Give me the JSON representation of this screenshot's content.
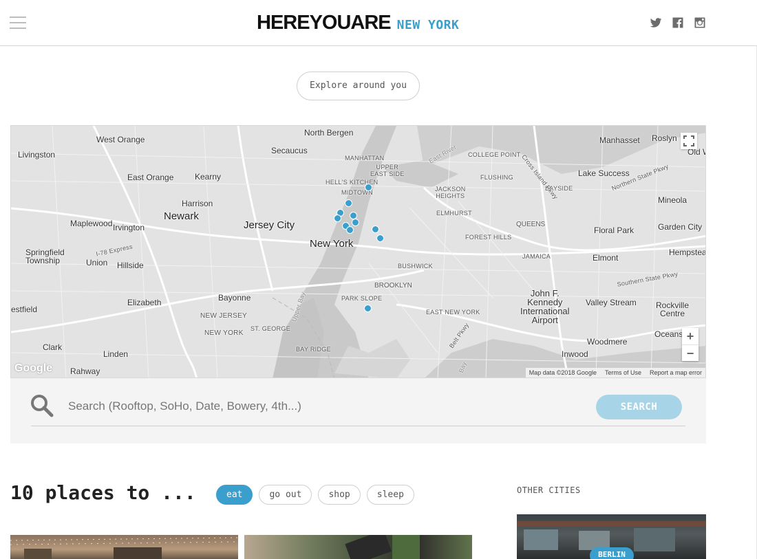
{
  "header": {
    "logo_main": "HEREYOUARE",
    "logo_city": "NEW YORK",
    "social": [
      "twitter-icon",
      "facebook-icon",
      "instagram-icon"
    ]
  },
  "explore": {
    "label": "Explore around you"
  },
  "map": {
    "labels": {
      "north_bergen": "North Bergen",
      "west_orange": "West Orange",
      "secaucus": "Secaucus",
      "livingston": "Livingston",
      "east_orange": "East Orange",
      "kearny": "Kearny",
      "harrison": "Harrison",
      "newark": "Newark",
      "maplewood": "Maplewood",
      "irvington": "Irvington",
      "jersey_city": "Jersey City",
      "new_york": "New York",
      "springfield": "Springfield\nTownship",
      "union": "Union",
      "hillside": "Hillside",
      "bayonne": "Bayonne",
      "elizabeth": "Elizabeth",
      "westfield": "estfield",
      "clark": "Clark",
      "linden": "Linden",
      "rahway": "Rahway",
      "manhattan": "MANHATTAN",
      "upper_east_side": "UPPER\nEAST SIDE",
      "hells_kitchen": "HELL'S KITCHEN",
      "midtown": "MIDTOWN",
      "college_point": "COLLEGE POINT",
      "flushing": "FLUSHING",
      "jackson_heights": "JACKSON\nHEIGHTS",
      "elmhurst": "ELMHURST",
      "forest_hills": "FOREST HILLS",
      "queens": "QUEENS",
      "bayside": "BAYSIDE",
      "jamaica": "JAMAICA",
      "bushwick": "BUSHWICK",
      "brooklyn": "BROOKLYN",
      "park_slope": "PARK SLOPE",
      "east_new_york": "EAST NEW YORK",
      "new_jersey": "NEW JERSEY",
      "new_york_state": "NEW YORK",
      "st_george": "ST. GEORGE",
      "bay_ridge": "BAY RIDGE",
      "manhasset": "Manhasset",
      "roslyn": "Roslyn",
      "old_w": "Old W",
      "lake_success": "Lake Success",
      "mineola": "Mineola",
      "floral_park": "Floral Park",
      "garden_city": "Garden City",
      "hempstead": "Hempstea",
      "elmont": "Elmont",
      "valley_stream": "Valley Stream",
      "rockville_centre": "Rockville\nCentre",
      "oceanside": "Oceansi",
      "woodmere": "Woodmere",
      "inwood": "Inwood",
      "jfk": "John F.\nKennedy\nInternational\nAirport",
      "cross_island": "Cross Island Pkwy",
      "northern_state": "Northern State Pkwy",
      "southern_state": "Southern State Pkwy",
      "belt_pkwy": "Belt Pkwy",
      "i78_express": "I-78 Express",
      "upper_bay": "Upper Bay",
      "east_river": "East River",
      "bay": "Bay"
    },
    "attribution": {
      "data": "Map data ©2018 Google",
      "terms": "Terms of Use",
      "report": "Report a map error"
    },
    "google": "Google",
    "zoom_in": "+",
    "zoom_out": "−"
  },
  "search": {
    "placeholder": "Search (Rooftop, SoHo, Date, Bowery, 4th...)",
    "button": "SEARCH"
  },
  "places": {
    "title": "10 places to ...",
    "filters": [
      "eat",
      "go out",
      "shop",
      "sleep"
    ],
    "active_filter": "eat"
  },
  "sidebar": {
    "heading": "OTHER CITIES",
    "city": "BERLIN"
  },
  "colors": {
    "accent": "#3a9fcd",
    "search_button": "#a7d4e6",
    "map_background": "#e5e5e5"
  }
}
